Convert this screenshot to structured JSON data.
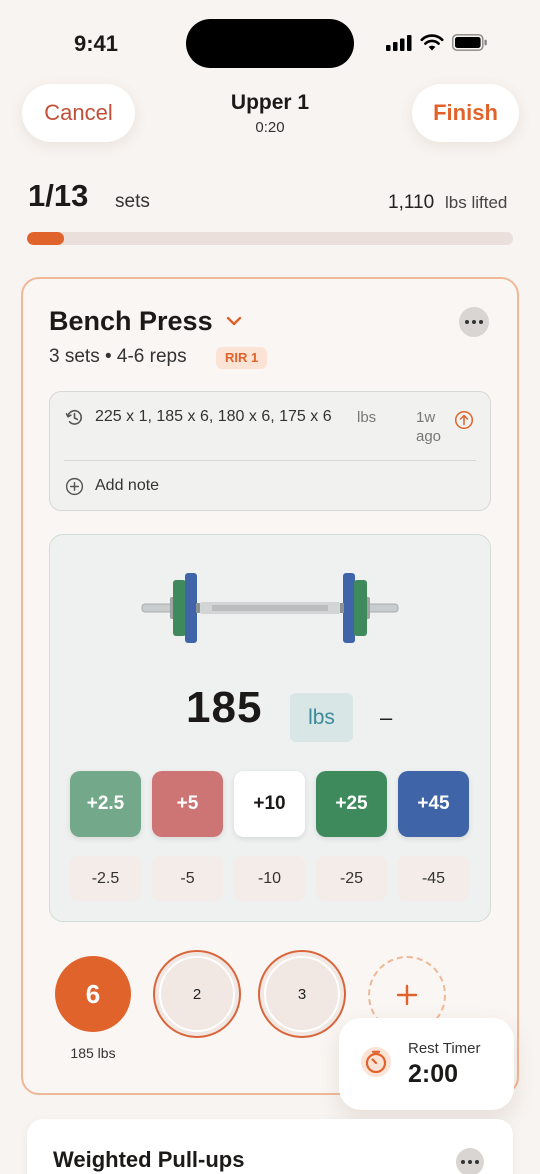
{
  "status_bar": {
    "time": "9:41"
  },
  "header": {
    "cancel_label": "Cancel",
    "finish_label": "Finish",
    "workout_title": "Upper 1",
    "elapsed": "0:20"
  },
  "progress": {
    "sets_done": "1/13",
    "sets_label": "sets",
    "lifted_value": "1,110",
    "lifted_label": "lbs lifted",
    "fraction": 0.077
  },
  "exercise": {
    "name": "Bench Press",
    "meta": "3 sets • 4-6 reps",
    "rir_badge": "RIR 1",
    "history": {
      "text": "225 x 1, 185 x 6, 180 x 6, 175 x 6",
      "unit": "lbs",
      "ago": "1w ago"
    },
    "add_note_label": "Add note",
    "weight": {
      "value": "185",
      "unit": "lbs",
      "dash": "–",
      "increments": [
        {
          "label": "+2.5",
          "color": "#74a88a"
        },
        {
          "label": "+5",
          "color": "#cd7474"
        },
        {
          "label": "+10",
          "color": "#ffffff"
        },
        {
          "label": "+25",
          "color": "#3f8a5c"
        },
        {
          "label": "+45",
          "color": "#3f65a8"
        }
      ],
      "decrements": [
        "-2.5",
        "-5",
        "-10",
        "-25",
        "-45"
      ]
    },
    "sets": [
      {
        "reps": "6",
        "weight": "185 lbs",
        "done": true
      },
      {
        "label": "2",
        "done": false
      },
      {
        "label": "3",
        "done": false
      }
    ]
  },
  "rest_timer": {
    "label": "Rest Timer",
    "value": "2:00"
  },
  "next_exercise": {
    "name": "Weighted Pull-ups"
  },
  "colors": {
    "accent": "#e0632c",
    "card_border": "#f0b896",
    "unit_text": "#3c8a9b"
  }
}
